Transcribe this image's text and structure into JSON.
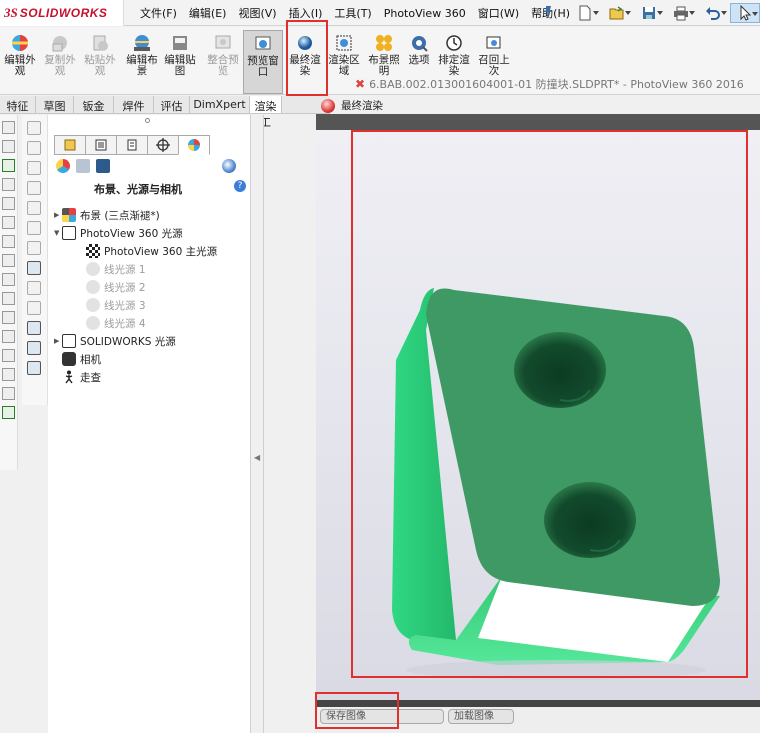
{
  "app": {
    "logo_prefix": "3S",
    "logo_name": "SOLIDWORKS"
  },
  "menus": [
    "文件(F)",
    "编辑(E)",
    "视图(V)",
    "插入(I)",
    "工具(T)",
    "PhotoView 360",
    "窗口(W)",
    "帮助(H)"
  ],
  "quick_access_icons": [
    "new-icon",
    "open-icon",
    "save-icon",
    "print-icon",
    "undo-icon",
    "select-arrow-icon"
  ],
  "ribbon": [
    {
      "l1": "编辑外",
      "l2": "观",
      "dis": false
    },
    {
      "l1": "复制外",
      "l2": "观",
      "dis": true
    },
    {
      "l1": "粘贴外",
      "l2": "观",
      "dis": true
    },
    {
      "l1": "编辑布",
      "l2": "景",
      "dis": false
    },
    {
      "l1": "编辑贴",
      "l2": "图",
      "dis": false
    },
    {
      "l1": "整合预",
      "l2": "览",
      "dis": true
    },
    {
      "l1": "预览窗",
      "l2": "口",
      "dis": false
    },
    {
      "l1": "最终渲",
      "l2": "染",
      "dis": false
    },
    {
      "l1": "渲染区",
      "l2": "域",
      "dis": false
    },
    {
      "l1": "布景照",
      "l2": "明",
      "dis": false
    },
    {
      "l1": "选项",
      "l2": "",
      "dis": false
    },
    {
      "l1": "排定渲",
      "l2": "染",
      "dis": false
    },
    {
      "l1": "召回上",
      "l2": "次",
      "dis": false
    }
  ],
  "tabs": [
    "特征",
    "草图",
    "钣金",
    "焊件",
    "评估",
    "DimXpert",
    "渲染工"
  ],
  "document_title": "6.BAB.002.013001604001-01 防撞块.SLDPRT* - PhotoView 360 2016",
  "panel": {
    "heading": "布景、光源与相机",
    "help": "?"
  },
  "tree": [
    {
      "label": "布景 (三点渐褪*)",
      "dim": false
    },
    {
      "label": "PhotoView 360 光源",
      "dim": false
    },
    {
      "label": "PhotoView 360 主光源",
      "dim": false
    },
    {
      "label": "线光源 1",
      "dim": true
    },
    {
      "label": "线光源 2",
      "dim": true
    },
    {
      "label": "线光源 3",
      "dim": true
    },
    {
      "label": "线光源 4",
      "dim": true
    },
    {
      "label": "SOLIDWORKS 光源",
      "dim": false
    },
    {
      "label": "相机",
      "dim": false
    },
    {
      "label": "走查",
      "dim": false
    }
  ],
  "render_window": {
    "title": "最终渲染",
    "save_button": "保存图像",
    "load_button": "加载图像"
  },
  "colors": {
    "accent_red": "#e0302e",
    "part_green": "#3fa06a"
  }
}
